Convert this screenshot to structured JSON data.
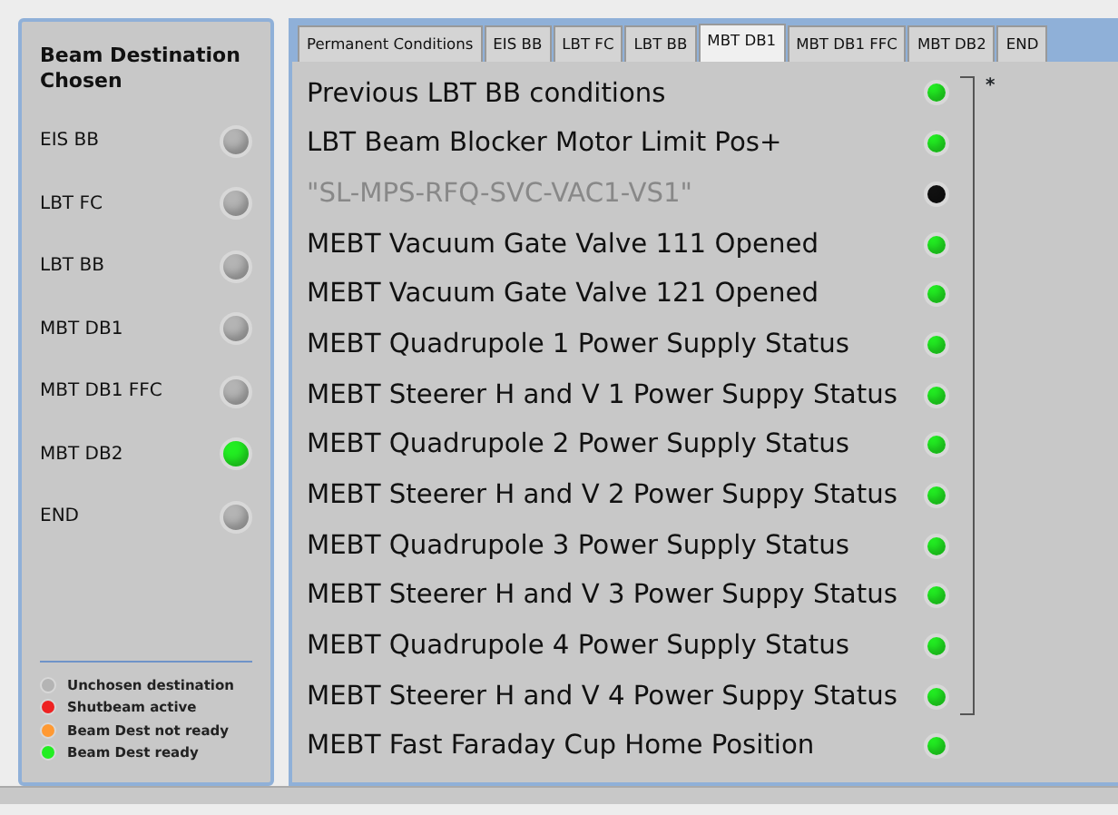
{
  "destinations": {
    "title": "Beam Destination Chosen",
    "items": [
      {
        "label": "EIS BB",
        "color": "#b4b4b4"
      },
      {
        "label": "LBT FC",
        "color": "#b4b4b4"
      },
      {
        "label": "LBT BB",
        "color": "#b4b4b4"
      },
      {
        "label": "MBT DB1",
        "color": "#b4b4b4"
      },
      {
        "label": "MBT DB1 FFC",
        "color": "#b4b4b4"
      },
      {
        "label": "MBT DB2",
        "color": "#22ee22"
      },
      {
        "label": "END",
        "color": "#b4b4b4"
      }
    ],
    "legend": [
      {
        "label": "Unchosen destination",
        "color": "#b4b4b4"
      },
      {
        "label": "Shutbeam active",
        "color": "#ee2222"
      },
      {
        "label": "Beam Dest not ready",
        "color": "#ff9933"
      },
      {
        "label": "Beam Dest ready",
        "color": "#22ee22"
      }
    ]
  },
  "tabs": [
    {
      "label": "Permanent Conditions",
      "selected": false
    },
    {
      "label": "EIS BB",
      "selected": false
    },
    {
      "label": "LBT FC",
      "selected": false
    },
    {
      "label": "LBT BB",
      "selected": false
    },
    {
      "label": "MBT DB1",
      "selected": true
    },
    {
      "label": "MBT DB1 FFC",
      "selected": false
    },
    {
      "label": "MBT DB2",
      "selected": false
    },
    {
      "label": "END",
      "selected": false
    }
  ],
  "conditions": {
    "group": {
      "note": "*",
      "rows": [
        {
          "label": "Previous LBT BB conditions",
          "color": "#22ee22",
          "disabled": false
        },
        {
          "label": "LBT Beam Blocker Motor Limit Pos+",
          "color": "#22ee22",
          "disabled": false
        },
        {
          "label": "\"SL-MPS-RFQ-SVC-VAC1-VS1\"",
          "color": "#111111",
          "disabled": true
        },
        {
          "label": "MEBT Vacuum Gate Valve 111 Opened",
          "color": "#22ee22",
          "disabled": false
        },
        {
          "label": "MEBT Vacuum Gate Valve 121 Opened",
          "color": "#22ee22",
          "disabled": false
        },
        {
          "label": "MEBT Quadrupole 1 Power Supply Status",
          "color": "#22ee22",
          "disabled": false
        },
        {
          "label": "MEBT Steerer H and V 1 Power Suppy Status",
          "color": "#22ee22",
          "disabled": false
        },
        {
          "label": "MEBT Quadrupole 2 Power Supply Status",
          "color": "#22ee22",
          "disabled": false
        },
        {
          "label": "MEBT Steerer H and V 2 Power Suppy Status",
          "color": "#22ee22",
          "disabled": false
        },
        {
          "label": "MEBT Quadrupole 3 Power Supply Status",
          "color": "#22ee22",
          "disabled": false
        },
        {
          "label": "MEBT Steerer H and V 3 Power Suppy Status",
          "color": "#22ee22",
          "disabled": false
        },
        {
          "label": "MEBT Quadrupole 4 Power Supply Status",
          "color": "#22ee22",
          "disabled": false
        },
        {
          "label": "MEBT Steerer H and V 4 Power Suppy Status",
          "color": "#22ee22",
          "disabled": false
        }
      ]
    },
    "rows": [
      {
        "label": "MEBT Fast Faraday Cup Home Position",
        "color": "#22ee22",
        "disabled": false
      }
    ]
  }
}
